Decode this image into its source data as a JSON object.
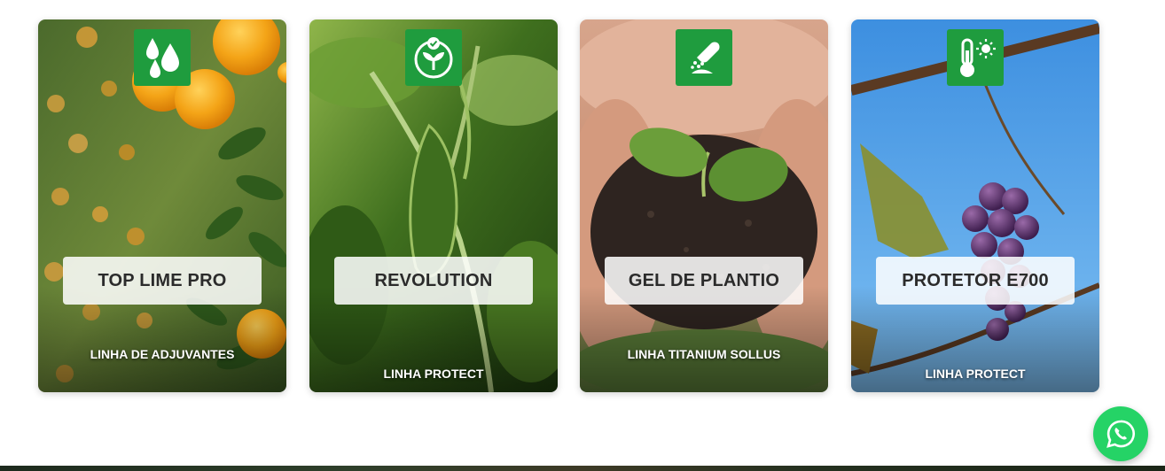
{
  "products": [
    {
      "title": "TOP LIME PRO",
      "line": "LINHA DE ADJUVANTES",
      "icon": "water-drops-icon"
    },
    {
      "title": "REVOLUTION",
      "line": "LINHA PROTECT",
      "icon": "plant-protection-icon"
    },
    {
      "title": "GEL DE PLANTIO",
      "line": "LINHA TITANIUM SOLLUS",
      "icon": "hand-planting-icon"
    },
    {
      "title": "PROTETOR E700",
      "line": "LINHA PROTECT",
      "icon": "thermometer-sun-icon"
    }
  ],
  "colors": {
    "badge": "#1f9c3e",
    "whatsapp": "#25d366"
  },
  "whatsapp": {
    "icon": "whatsapp-icon"
  }
}
